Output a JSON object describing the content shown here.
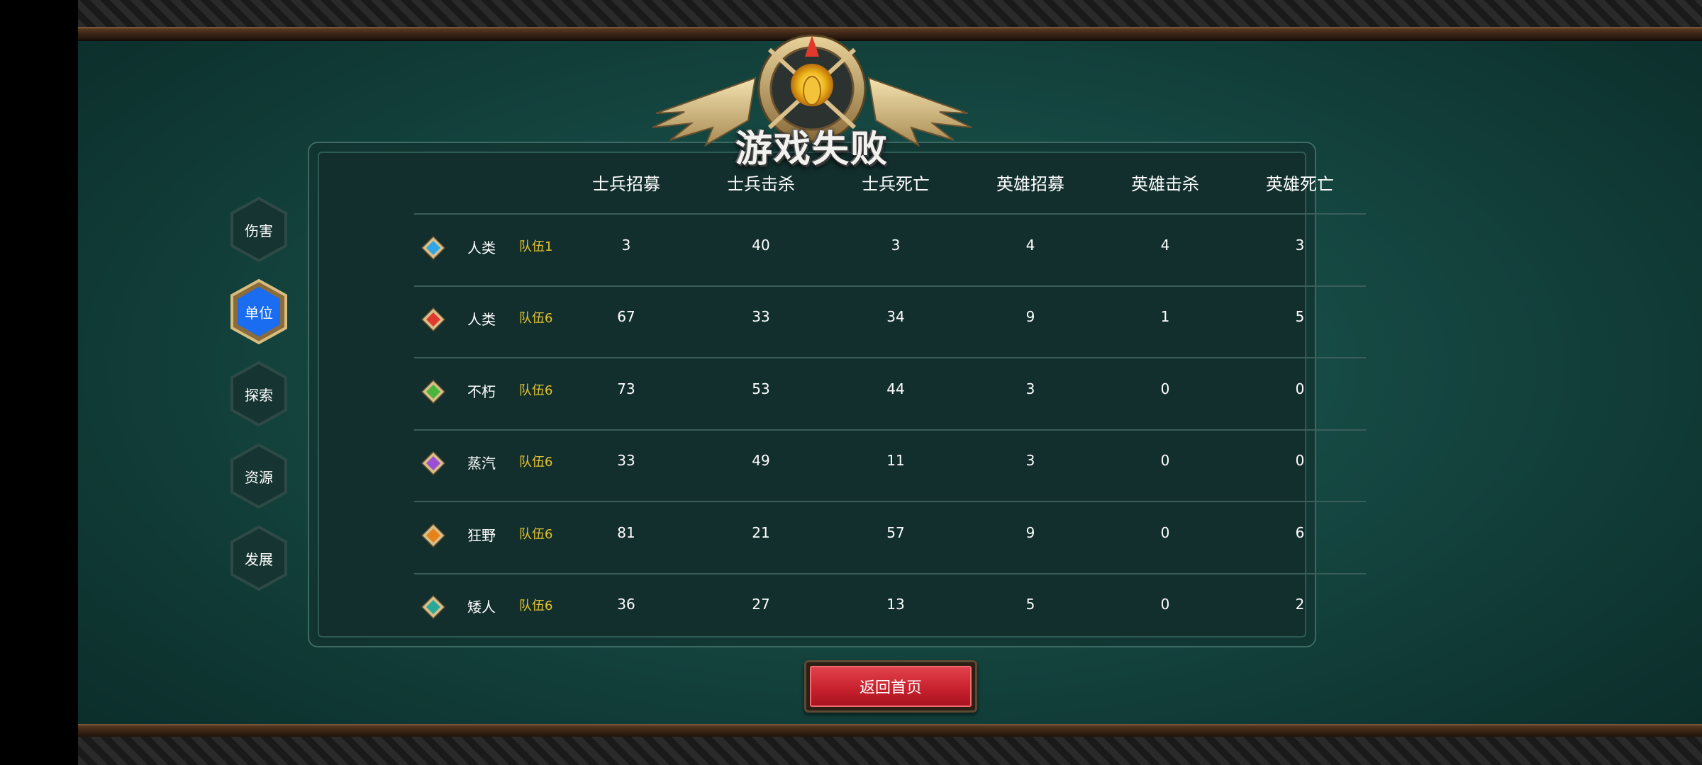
{
  "title": "游戏失败",
  "side_tabs": [
    {
      "label": "伤害",
      "active": false
    },
    {
      "label": "单位",
      "active": true
    },
    {
      "label": "探索",
      "active": false
    },
    {
      "label": "资源",
      "active": false
    },
    {
      "label": "发展",
      "active": false
    }
  ],
  "columns": [
    "士兵招募",
    "士兵击杀",
    "士兵死亡",
    "英雄招募",
    "英雄击杀",
    "英雄死亡"
  ],
  "rows": [
    {
      "race": "人类",
      "team": "队伍1",
      "gem_icon": "blue-gem-icon",
      "gem_color": "#2fa7e8",
      "values": [
        "3",
        "40",
        "3",
        "4",
        "4",
        "3"
      ]
    },
    {
      "race": "人类",
      "team": "队伍6",
      "gem_icon": "red-gem-icon",
      "gem_color": "#e03a2f",
      "values": [
        "67",
        "33",
        "34",
        "9",
        "1",
        "5"
      ]
    },
    {
      "race": "不朽",
      "team": "队伍6",
      "gem_icon": "green-gem-icon",
      "gem_color": "#49b53a",
      "values": [
        "73",
        "53",
        "44",
        "3",
        "0",
        "0"
      ]
    },
    {
      "race": "蒸汽",
      "team": "队伍6",
      "gem_icon": "purple-gem-icon",
      "gem_color": "#9a4fd4",
      "values": [
        "33",
        "49",
        "11",
        "3",
        "0",
        "0"
      ]
    },
    {
      "race": "狂野",
      "team": "队伍6",
      "gem_icon": "orange-gem-icon",
      "gem_color": "#e5821c",
      "values": [
        "81",
        "21",
        "57",
        "9",
        "0",
        "6"
      ]
    },
    {
      "race": "矮人",
      "team": "队伍6",
      "gem_icon": "teal-gem-icon",
      "gem_color": "#2aa99a",
      "values": [
        "36",
        "27",
        "13",
        "5",
        "0",
        "2"
      ]
    }
  ],
  "return_button": "返回首页",
  "colors": {
    "active_tab": "#1a6cf0",
    "team_label": "#e4c233",
    "button": "#c8222e"
  }
}
